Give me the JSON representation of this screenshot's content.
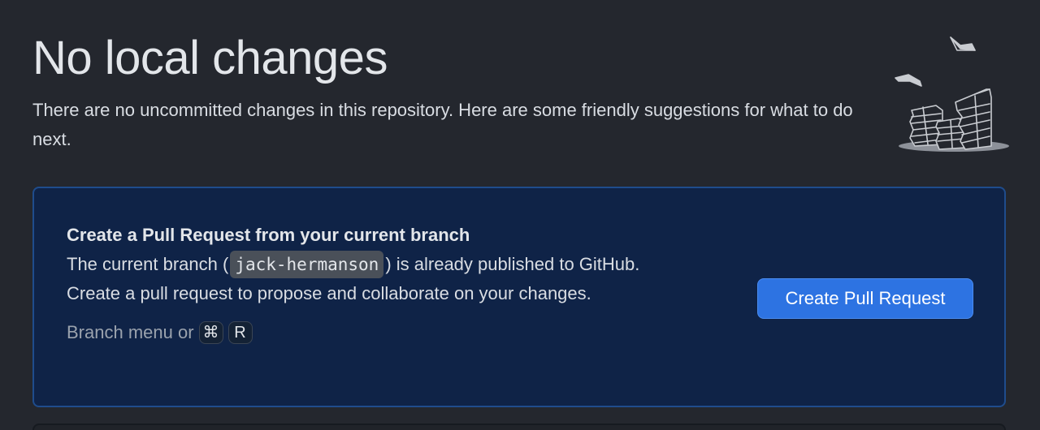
{
  "header": {
    "title": "No local changes",
    "subtitle": "There are no uncommitted changes in this repository. Here are some friendly suggestions for what to do next."
  },
  "illustration": {
    "icon": "papers-stack-icon"
  },
  "suggestion": {
    "title": "Create a Pull Request from your current branch",
    "desc_before": "The current branch (",
    "branch": "jack-hermanson",
    "desc_after": ") is already published to GitHub. Create a pull request to propose and collaborate on your changes.",
    "shortcut_label": "Branch menu or",
    "shortcut_keys": [
      "⌘",
      "R"
    ],
    "button_label": "Create Pull Request"
  },
  "colors": {
    "background": "#24272e",
    "card_background": "#0f2347",
    "card_border": "#1f4c8c",
    "button": "#2d73e2"
  }
}
